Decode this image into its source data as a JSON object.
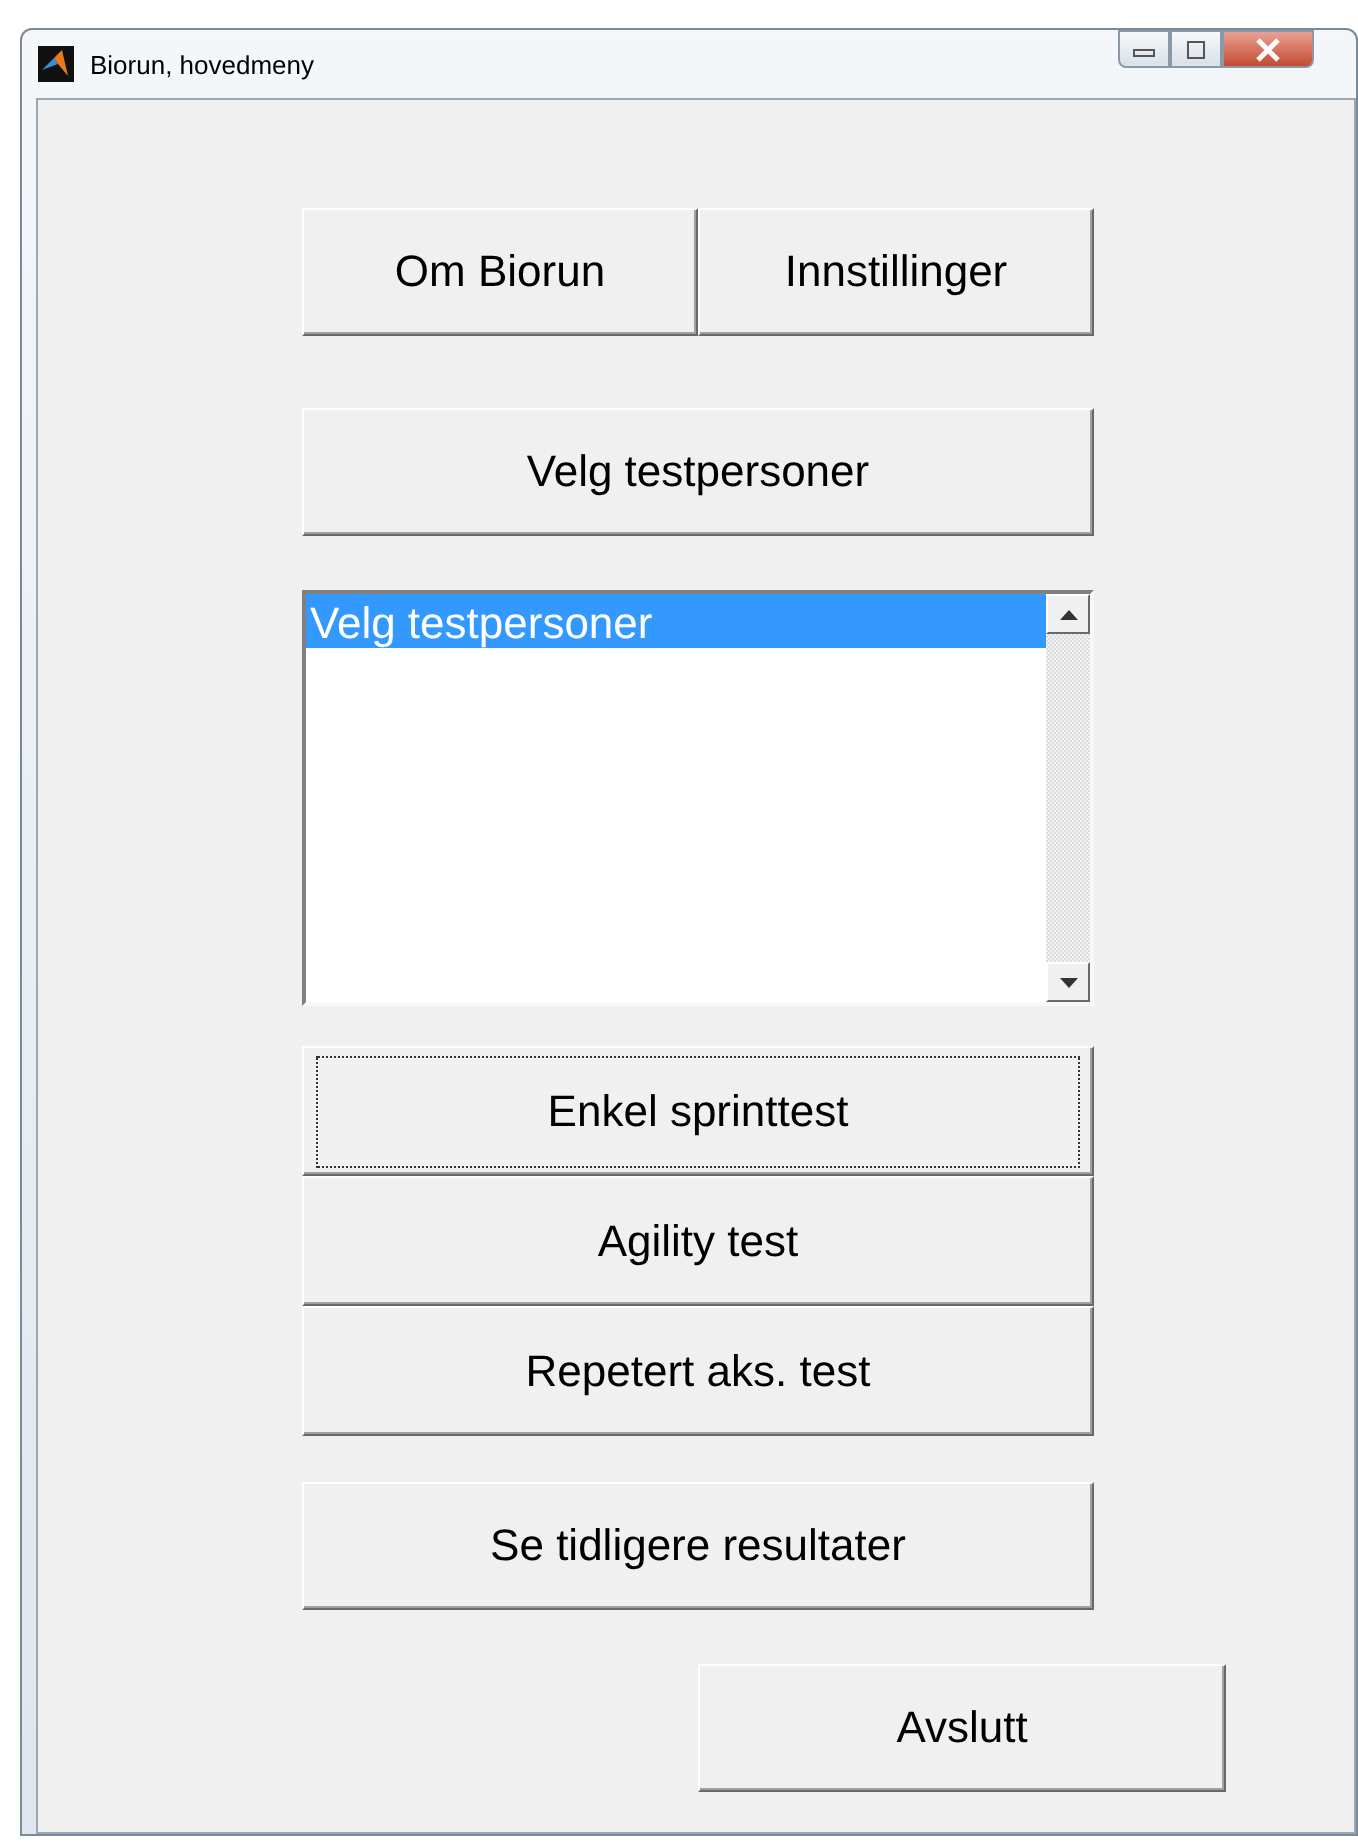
{
  "window": {
    "title": "Biorun, hovedmeny"
  },
  "top_buttons": [
    "Om Biorun",
    "Innstillinger"
  ],
  "select_button": "Velg testpersoner",
  "listbox": {
    "items": [
      {
        "label": "Velg testpersoner",
        "selected": true
      }
    ]
  },
  "test_buttons": [
    {
      "label": "Enkel sprinttest",
      "focused": true
    },
    {
      "label": "Agility test",
      "focused": false
    },
    {
      "label": "Repetert aks. test",
      "focused": false
    }
  ],
  "results_button": "Se tidligere resultater",
  "exit_button": "Avslutt"
}
